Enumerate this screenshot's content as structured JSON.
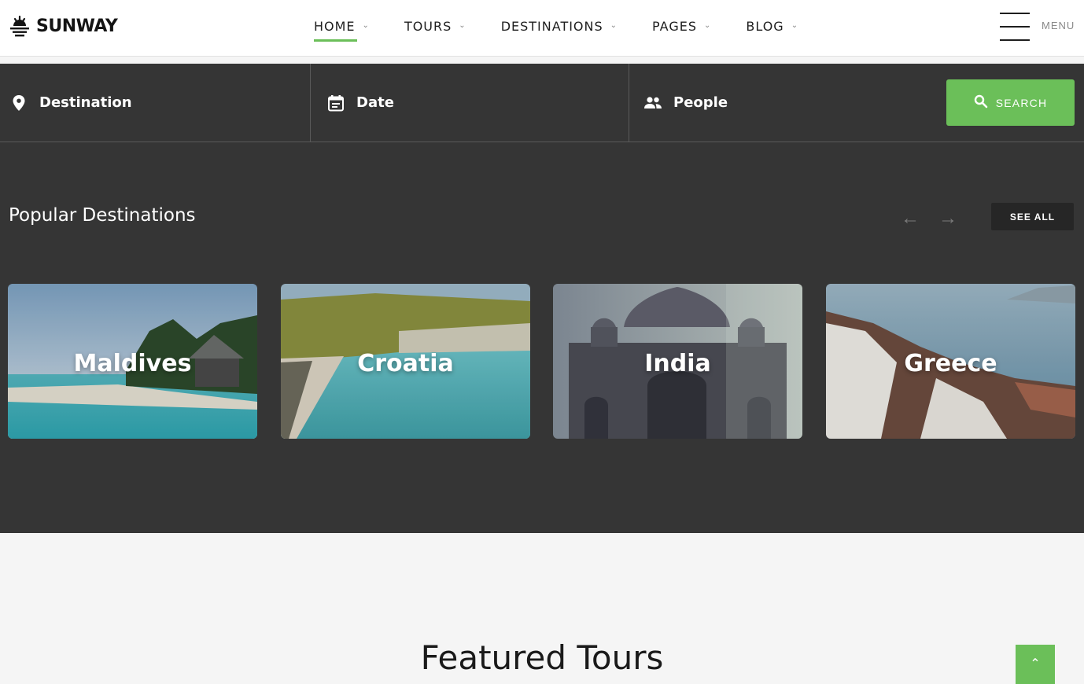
{
  "brand": {
    "name": "SUNWAY",
    "accent": "#6bbf59"
  },
  "nav": {
    "items": [
      {
        "label": "HOME",
        "active": true
      },
      {
        "label": "TOURS",
        "active": false
      },
      {
        "label": "DESTINATIONS",
        "active": false
      },
      {
        "label": "PAGES",
        "active": false
      },
      {
        "label": "BLOG",
        "active": false
      }
    ],
    "menu_label": "MENU"
  },
  "search": {
    "destination_label": "Destination",
    "date_label": "Date",
    "people_label": "People",
    "button_label": "SEARCH"
  },
  "popular": {
    "title": "Popular Destinations",
    "see_all": "SEE ALL",
    "cards": [
      {
        "name": "Maldives"
      },
      {
        "name": "Croatia"
      },
      {
        "name": "India"
      },
      {
        "name": "Greece"
      }
    ]
  },
  "featured": {
    "title": "Featured Tours"
  }
}
